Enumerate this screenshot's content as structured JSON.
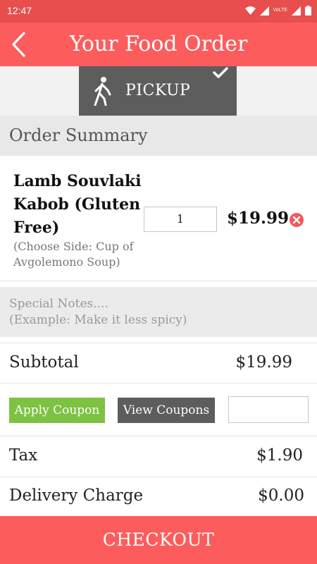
{
  "status_bar": {
    "time": "12:47",
    "network_label": "VoLTE",
    "icons": [
      "wifi-icon",
      "signal-icon",
      "volte-icon",
      "signal-icon",
      "battery-icon"
    ]
  },
  "header": {
    "title": "Your Food Order",
    "back_icon": "chevron-left-icon",
    "bg_color": "#fd5c5c"
  },
  "order_type": {
    "label": "PICKUP",
    "icon": "walker-icon",
    "selected": true,
    "selected_icon": "check-icon"
  },
  "summary": {
    "heading": "Order Summary",
    "items": [
      {
        "name": "Lamb Souvlaki Kabob (Gluten Free)",
        "option": "(Choose Side: Cup of Avgolemono Soup)",
        "quantity": "1",
        "price": "$19.99",
        "remove_icon": "remove-icon"
      }
    ]
  },
  "notes": {
    "placeholder": "Special Notes....\n(Example: Make it less spicy)"
  },
  "totals": {
    "subtotal_label": "Subtotal",
    "subtotal_value": "$19.99",
    "tax_label": "Tax",
    "tax_value": "$1.90",
    "delivery_label": "Delivery Charge",
    "delivery_value": "$0.00"
  },
  "coupon": {
    "apply_label": "Apply Coupon",
    "view_label": "View Coupons",
    "input_value": "",
    "apply_color": "#7dc242"
  },
  "checkout": {
    "label": "CHECKOUT"
  }
}
